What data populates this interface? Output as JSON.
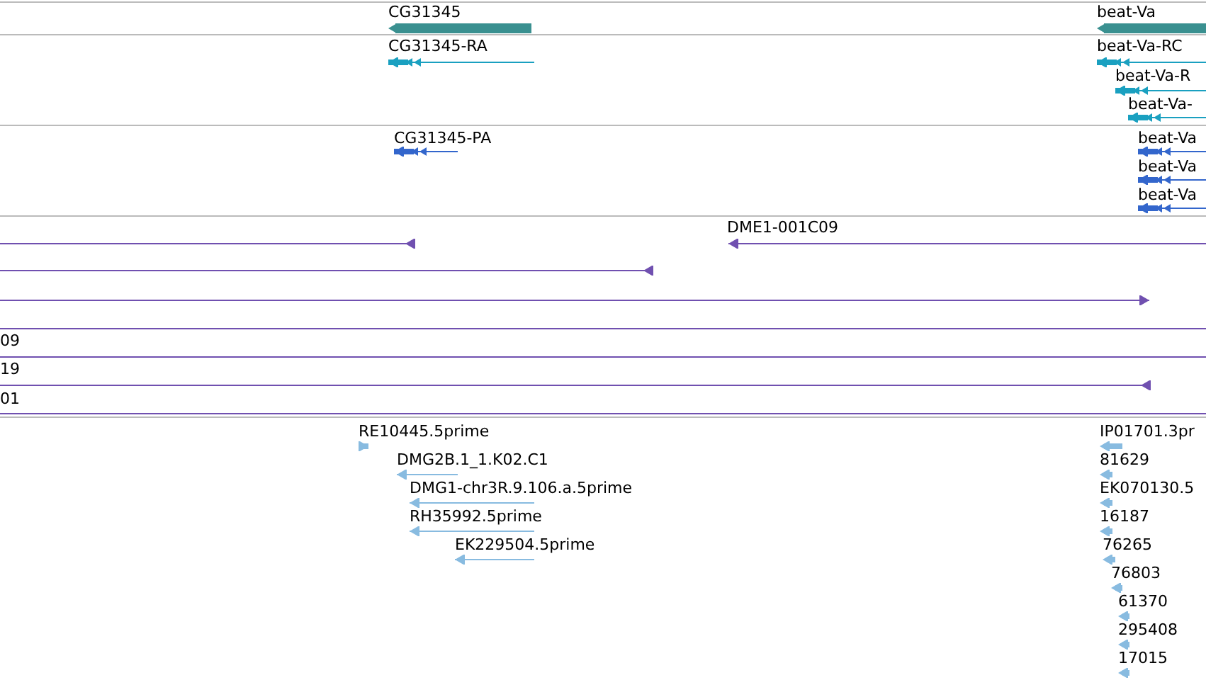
{
  "tracks": [
    {
      "color": "#3a9090",
      "features": [
        {
          "kind": "gene",
          "label": "CG31345",
          "reverse": true,
          "arrowhead": true
        },
        {
          "kind": "gene",
          "label": "beat-Va",
          "reverse": true,
          "arrowhead": true
        }
      ]
    },
    {
      "color": "#1aa0c0",
      "features": [
        {
          "kind": "transcript",
          "label": "CG31345-RA",
          "reverse": true,
          "arrowhead": true
        },
        {
          "kind": "transcript",
          "label": "beat-Va-RC",
          "reverse": true,
          "arrowhead": true
        },
        {
          "kind": "transcript",
          "label": "beat-Va-R",
          "reverse": true,
          "arrowhead": true
        },
        {
          "kind": "transcript",
          "label": "beat-Va-",
          "reverse": true,
          "arrowhead": true
        }
      ]
    },
    {
      "color": "#3366cc",
      "features": [
        {
          "kind": "transcript",
          "label": "CG31345-PA",
          "reverse": true,
          "arrowhead": true
        },
        {
          "kind": "transcript",
          "label": "beat-Va",
          "reverse": true,
          "arrowhead": true
        },
        {
          "kind": "transcript",
          "label": "beat-Va",
          "reverse": true,
          "arrowhead": true
        },
        {
          "kind": "transcript",
          "label": "beat-Va",
          "reverse": true,
          "arrowhead": true
        }
      ]
    },
    {
      "color": "#7050b0",
      "features": [
        {
          "kind": "span",
          "reverse": true,
          "arrowhead": true
        },
        {
          "kind": "span",
          "label": "DME1-001C09",
          "reverse": true,
          "arrowhead": true
        },
        {
          "kind": "span",
          "reverse": true,
          "arrowhead": true
        },
        {
          "kind": "span",
          "reverse": false,
          "arrowhead": true
        },
        {
          "kind": "span"
        },
        {
          "kind": "span",
          "label": "09"
        },
        {
          "kind": "span",
          "label": "19",
          "reverse": true,
          "arrowhead": true
        },
        {
          "kind": "span",
          "label": "01"
        }
      ]
    },
    {
      "color": "#88bbe0",
      "features": [
        {
          "kind": "block",
          "label": "RE10445.5prime",
          "reverse": false,
          "arrowhead": true
        },
        {
          "kind": "span",
          "label": "DMG2B.1_1.K02.C1",
          "reverse": true,
          "arrowhead": true
        },
        {
          "kind": "span",
          "label": "DMG1-chr3R.9.106.a.5prime",
          "reverse": true,
          "arrowhead": true
        },
        {
          "kind": "span",
          "label": "RH35992.5prime",
          "reverse": true,
          "arrowhead": true
        },
        {
          "kind": "span",
          "label": "EK229504.5prime",
          "reverse": true,
          "arrowhead": true
        },
        {
          "kind": "block",
          "label": "IP01701.3pr",
          "reverse": true,
          "arrowhead": true
        },
        {
          "kind": "block",
          "label": "81629",
          "reverse": true,
          "arrowhead": true
        },
        {
          "kind": "block",
          "label": "EK070130.5",
          "reverse": true,
          "arrowhead": true
        },
        {
          "kind": "block",
          "label": "16187",
          "reverse": true,
          "arrowhead": true
        },
        {
          "kind": "block",
          "label": "76265",
          "reverse": true,
          "arrowhead": true
        },
        {
          "kind": "block",
          "label": "76803",
          "reverse": true,
          "arrowhead": true
        },
        {
          "kind": "block",
          "label": "61370",
          "reverse": true,
          "arrowhead": true
        },
        {
          "kind": "block",
          "label": "295408",
          "reverse": true,
          "arrowhead": true
        },
        {
          "kind": "block",
          "label": "17015",
          "reverse": true,
          "arrowhead": true
        }
      ]
    }
  ]
}
